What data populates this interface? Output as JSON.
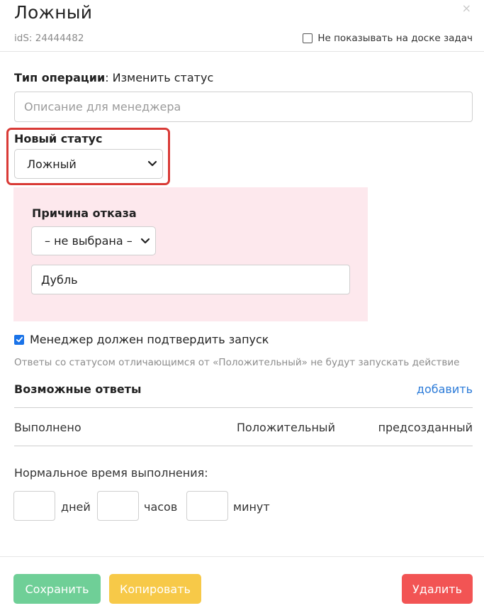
{
  "header": {
    "title": "Ложный",
    "close_glyph": "×",
    "ids_text": "idS: 24444482",
    "hide_on_board_label": "Не показывать на доске задач",
    "hide_on_board_checked": false
  },
  "operation": {
    "type_label": "Тип операции",
    "type_value": ": Изменить статус",
    "description_placeholder": "Описание для менеджера",
    "description_value": ""
  },
  "new_status": {
    "label": "Новый статус",
    "selected": "Ложный",
    "highlight_color": "#d93a36"
  },
  "reject_reason": {
    "label": "Причина отказа",
    "selected": "– не выбрана –",
    "text_value": "Дубль",
    "panel_color": "#fde8ed"
  },
  "confirm": {
    "label": "Менеджер должен подтвердить запуск",
    "checked": true
  },
  "hint": "Ответы со статусом отличающимся от «Положительный» не будут запускать действие",
  "answers": {
    "title": "Возможные ответы",
    "add_label": "добавить",
    "rows": [
      {
        "name": "Выполнено",
        "status": "Положительный",
        "kind": "предсозданный"
      }
    ]
  },
  "normal_time": {
    "label": "Нормальное время выполнения:",
    "days_value": "",
    "days_label": "дней",
    "hours_value": "",
    "hours_label": "часов",
    "minutes_value": "",
    "minutes_label": "минут"
  },
  "buttons": {
    "save": {
      "label": "Сохранить",
      "color": "#6fcf97"
    },
    "copy": {
      "label": "Копировать",
      "color": "#f7c948"
    },
    "delete": {
      "label": "Удалить",
      "color": "#f25454"
    }
  },
  "icons": {
    "close": "close-icon",
    "chevron": "chevron-down-icon",
    "checkbox": "checkbox-icon",
    "check": "check-icon"
  }
}
